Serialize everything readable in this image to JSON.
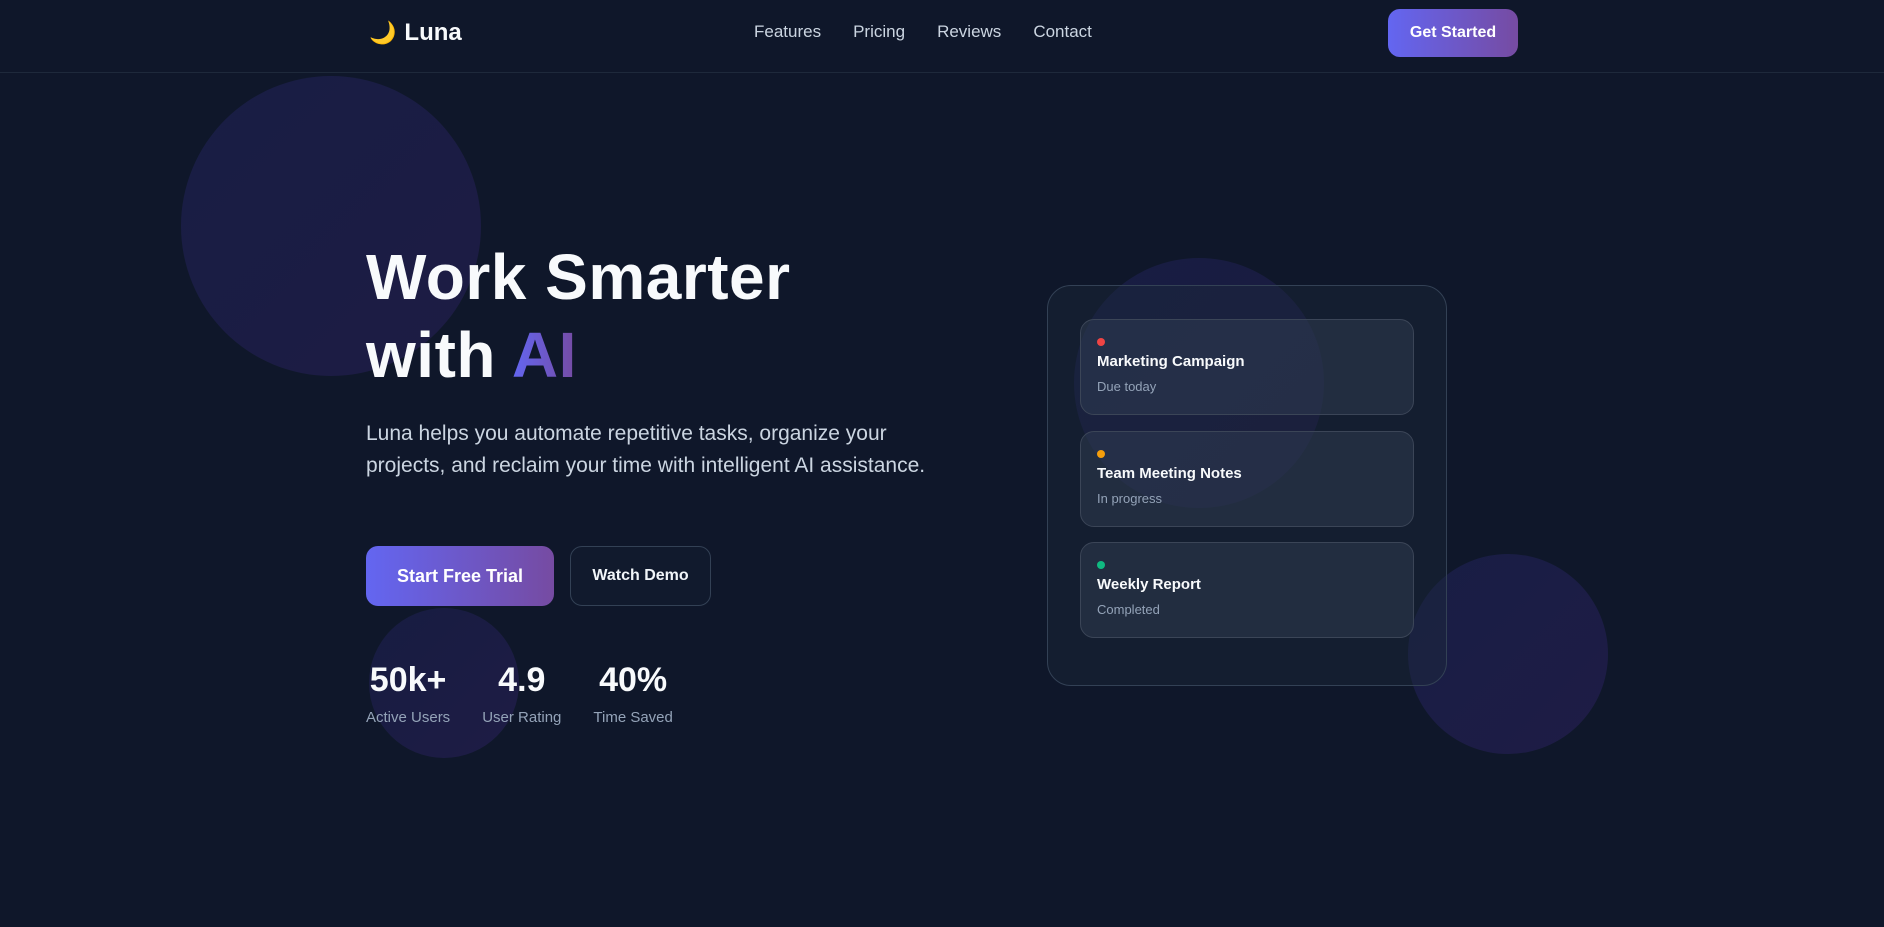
{
  "brand": {
    "icon": "🌙",
    "icon_name": "moon-icon",
    "name": "Luna"
  },
  "nav": {
    "items": [
      "Features",
      "Pricing",
      "Reviews",
      "Contact"
    ],
    "cta_label": "Get Started"
  },
  "hero": {
    "title_line1": "Work Smarter",
    "title_line2_prefix": "with ",
    "title_accent": "AI",
    "description": "Luna helps you automate repetitive tasks, organize your projects, and reclaim your time with intelligent AI assistance.",
    "primary_button": "Start Free Trial",
    "secondary_button": "Watch Demo"
  },
  "stats": [
    {
      "value": "50k+",
      "label": "Active Users"
    },
    {
      "value": "4.9",
      "label": "User Rating"
    },
    {
      "value": "40%",
      "label": "Time Saved"
    }
  ],
  "tasks": [
    {
      "title": "Marketing Campaign",
      "status": "Due today",
      "color": "#ef4444"
    },
    {
      "title": "Team Meeting Notes",
      "status": "In progress",
      "color": "#f59e0b"
    },
    {
      "title": "Weekly Report",
      "status": "Completed",
      "color": "#10b981"
    }
  ],
  "theme": {
    "background": "#0f172a",
    "accent_start": "#6366f1",
    "accent_end": "#764ba2"
  }
}
